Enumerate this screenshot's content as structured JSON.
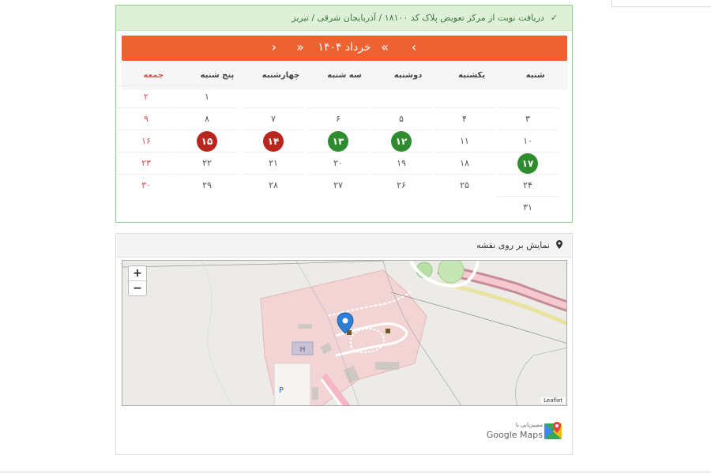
{
  "header": {
    "title": "دریافت نوبت از مرکز تعویض پلاک کد ۱۸۱۰۰ / آذربایجان شرقی / تبریز"
  },
  "calendar": {
    "month_title": "خرداد ۱۴۰۴",
    "nav": {
      "prev_year": "«",
      "next_year": "»",
      "prev_month": "‹",
      "next_month": "›"
    },
    "weekdays": [
      "شنبه",
      "یکشنبه",
      "دوشنبه",
      "سه شنبه",
      "چهارشنبه",
      "پنج شنبه",
      "جمعه"
    ],
    "rows": [
      [
        "",
        "",
        "",
        "",
        "",
        "۱",
        "۲"
      ],
      [
        "۳",
        "۴",
        "۵",
        "۶",
        "۷",
        "۸",
        "۹"
      ],
      [
        "۱۰",
        "۱۱",
        "۱۲",
        "۱۳",
        "۱۴",
        "۱۵",
        "۱۶"
      ],
      [
        "۱۷",
        "۱۸",
        "۱۹",
        "۲۰",
        "۲۱",
        "۲۲",
        "۲۳"
      ],
      [
        "۲۴",
        "۲۵",
        "۲۶",
        "۲۷",
        "۲۸",
        "۲۹",
        "۳۰"
      ],
      [
        "۳۱",
        "",
        "",
        "",
        "",
        "",
        ""
      ]
    ],
    "available_days": [
      "۱۲",
      "۱۳",
      "۱۷"
    ],
    "full_days": [
      "۱۴",
      "۱۵"
    ],
    "colors": {
      "bar": "#ee6231",
      "available": "#2e8b2e",
      "full": "#b8261d",
      "friday": "#d9534f"
    }
  },
  "map": {
    "title": "نمایش بر روی نقشه",
    "zoom_in": "+",
    "zoom_out": "−",
    "attribution": "Leaflet",
    "route_label": "مسیریابی با",
    "google_maps": "Google Maps",
    "icons": [
      "map-marker-icon",
      "zoom-in-icon",
      "zoom-out-icon",
      "google-maps-icon"
    ]
  }
}
